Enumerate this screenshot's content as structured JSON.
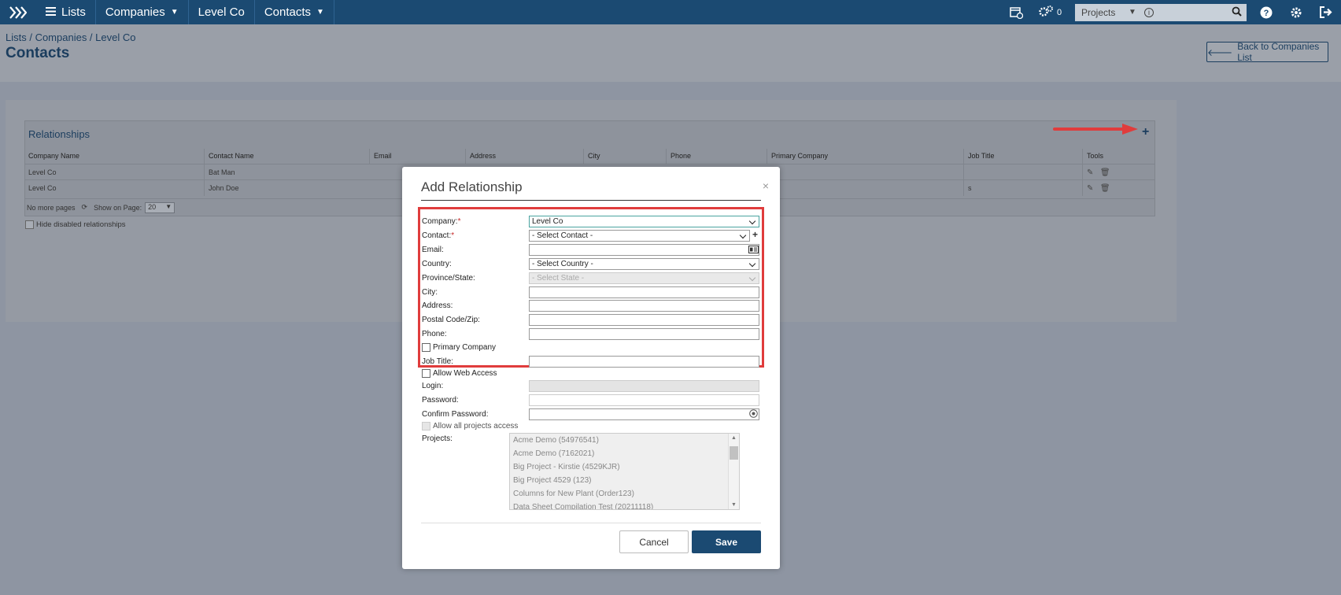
{
  "nav": {
    "items": [
      {
        "label": "Lists",
        "icon": "list-icon"
      },
      {
        "label": "Companies",
        "icon": "chevron-down-icon"
      },
      {
        "label": "Level Co"
      },
      {
        "label": "Contacts",
        "icon": "chevron-down-icon"
      }
    ],
    "task_count": "0",
    "project_select": "Projects"
  },
  "header": {
    "breadcrumb": "Lists / Companies / Level Co",
    "title": "Contacts",
    "back_label": "Back to Companies List"
  },
  "relationships": {
    "title": "Relationships",
    "columns": [
      "Company Name",
      "Contact Name",
      "Email",
      "Address",
      "City",
      "Phone",
      "Primary Company",
      "Job Title",
      "Tools"
    ],
    "rows": [
      {
        "company": "Level Co",
        "contact": "Bat Man",
        "job": ""
      },
      {
        "company": "Level Co",
        "contact": "John Doe",
        "job": "s"
      }
    ],
    "pager_text": "No more pages",
    "show_on_page_label": "Show on Page:",
    "page_size": "20",
    "hide_disabled_label": "Hide disabled relationships"
  },
  "modal": {
    "title": "Add Relationship",
    "close": "×",
    "fields": {
      "company_label": "Company:",
      "company_value": "Level Co",
      "contact_label": "Contact:",
      "contact_value": "- Select Contact -",
      "email_label": "Email:",
      "country_label": "Country:",
      "country_value": "- Select Country -",
      "state_label": "Province/State:",
      "state_value": "- Select State -",
      "city_label": "City:",
      "address_label": "Address:",
      "postal_label": "Postal Code/Zip:",
      "phone_label": "Phone:",
      "primary_company_label": "Primary Company",
      "job_title_label": "Job Title:",
      "web_access_label": "Allow Web Access",
      "login_label": "Login:",
      "password_label": "Password:",
      "confirm_password_label": "Confirm Password:",
      "all_projects_label": "Allow all projects access",
      "projects_label": "Projects:"
    },
    "projects": [
      "Acme Demo (54976541)",
      "Acme Demo (7162021)",
      "Big Project - Kirstie (4529KJR)",
      "Big Project 4529 (123)",
      "Columns for New Plant (Order123)",
      "Data Sheet Compilation Test (20211118)"
    ],
    "cancel_label": "Cancel",
    "save_label": "Save"
  },
  "colors": {
    "nav_bg": "#1b4a72",
    "highlight_red": "#e03c3c",
    "save_bg": "#1b4a72"
  }
}
